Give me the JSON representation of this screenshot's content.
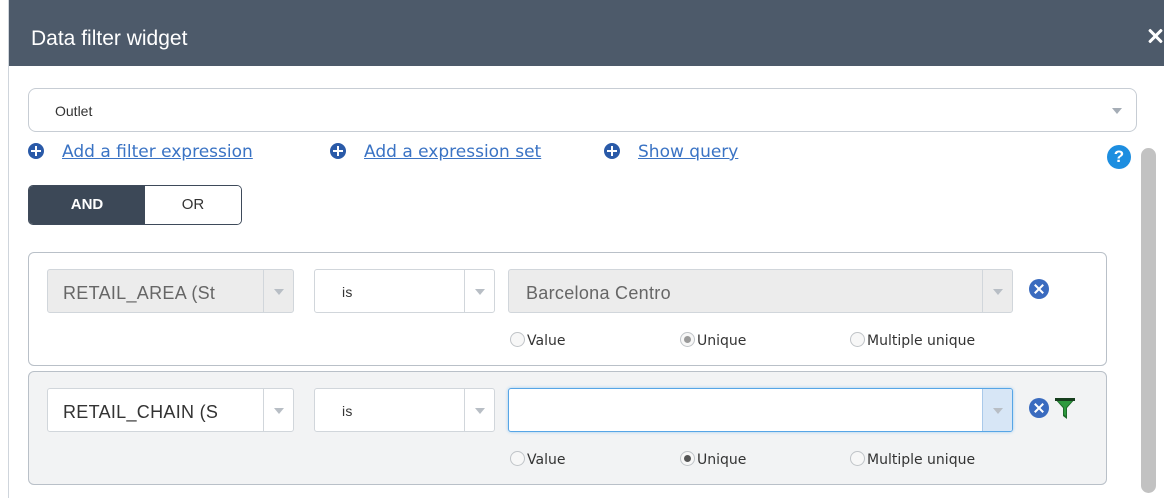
{
  "window": {
    "title": "Data filter widget"
  },
  "layer_select": {
    "value": "Outlet"
  },
  "actions": {
    "add_filter_expression": "Add a filter expression",
    "add_expression_set": "Add a expression set",
    "show_query": "Show query"
  },
  "logic_toggle": {
    "and_label": "AND",
    "or_label": "OR",
    "selected": "AND"
  },
  "expressions": [
    {
      "field": "RETAIL_AREA (St",
      "operator": "is",
      "value": "Barcelona Centro",
      "disabled": true,
      "radio_options": [
        "Value",
        "Unique",
        "Multiple unique"
      ],
      "radio_selected": "Unique"
    },
    {
      "field": "RETAIL_CHAIN (S",
      "operator": "is",
      "value": "",
      "disabled": false,
      "radio_options": [
        "Value",
        "Unique",
        "Multiple unique"
      ],
      "radio_selected": "Unique"
    }
  ],
  "colors": {
    "titlebar": "#4d5a6a",
    "link": "#3a73c4",
    "help": "#1d8ee0",
    "filter_icon_green": "#2e7d32"
  },
  "icons": [
    "close-icon",
    "dropdown-caret-icon",
    "plus-circle-icon",
    "help-icon",
    "remove-circle-icon",
    "filter-icon",
    "radio-icon"
  ]
}
